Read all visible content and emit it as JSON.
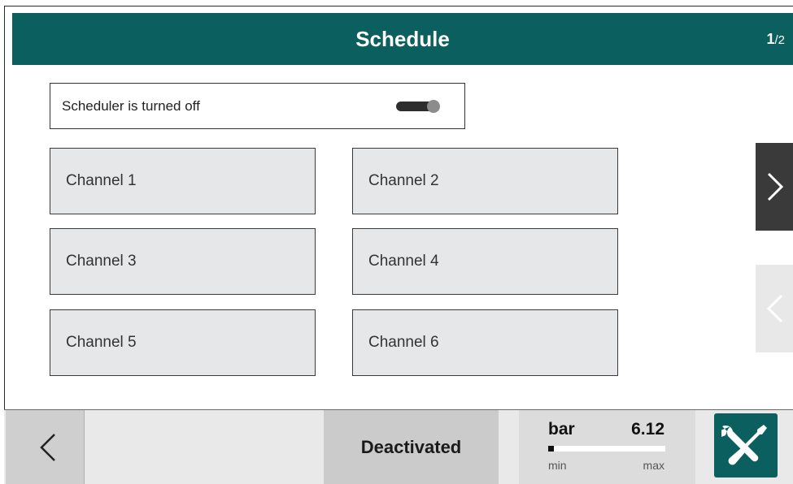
{
  "header": {
    "title": "Schedule",
    "page_current": "1",
    "page_total": "/2"
  },
  "scheduler": {
    "label": "Scheduler is turned off",
    "enabled": false
  },
  "channels": [
    {
      "label": "Channel 1"
    },
    {
      "label": "Channel 2"
    },
    {
      "label": "Channel 3"
    },
    {
      "label": "Channel 4"
    },
    {
      "label": "Channel 5"
    },
    {
      "label": "Channel 6"
    }
  ],
  "footer": {
    "status": "Deactivated",
    "gauge": {
      "unit": "bar",
      "value": "6.12",
      "min_label": "min",
      "max_label": "max",
      "fill_fraction": 0.05
    }
  },
  "icons": {
    "next": "chevron-right-icon",
    "prev": "chevron-left-icon",
    "back": "chevron-left-icon",
    "tools": "wrench-screwdriver-icon"
  },
  "colors": {
    "header_bg": "#0b5f5f",
    "tools_bg": "#0b5f5f"
  }
}
